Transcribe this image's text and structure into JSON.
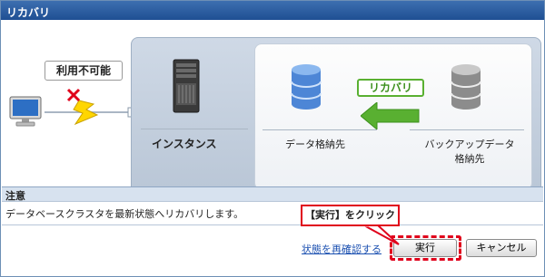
{
  "window": {
    "title": "リカバリ"
  },
  "diagram": {
    "unavailable_label": "利用不可能",
    "instance_label": "インスタンス",
    "data_dest_label": "データ格納先",
    "backup_dest_label_line1": "バックアップデータ",
    "backup_dest_label_line2": "格納先",
    "recover_tag": "リカバリ"
  },
  "notice": {
    "heading": "注意",
    "message": "データベースクラスタを最新状態へリカバリします。"
  },
  "footer": {
    "recheck_link": "状態を再確認する",
    "execute_label": "実行",
    "cancel_label": "キャンセル"
  },
  "annotation": {
    "callout": "【実行】をクリック"
  },
  "colors": {
    "title_bar": "#2a5ca0",
    "accent_green": "#59b031",
    "highlight_red": "#e0001b",
    "link_blue": "#1a4fb0"
  }
}
